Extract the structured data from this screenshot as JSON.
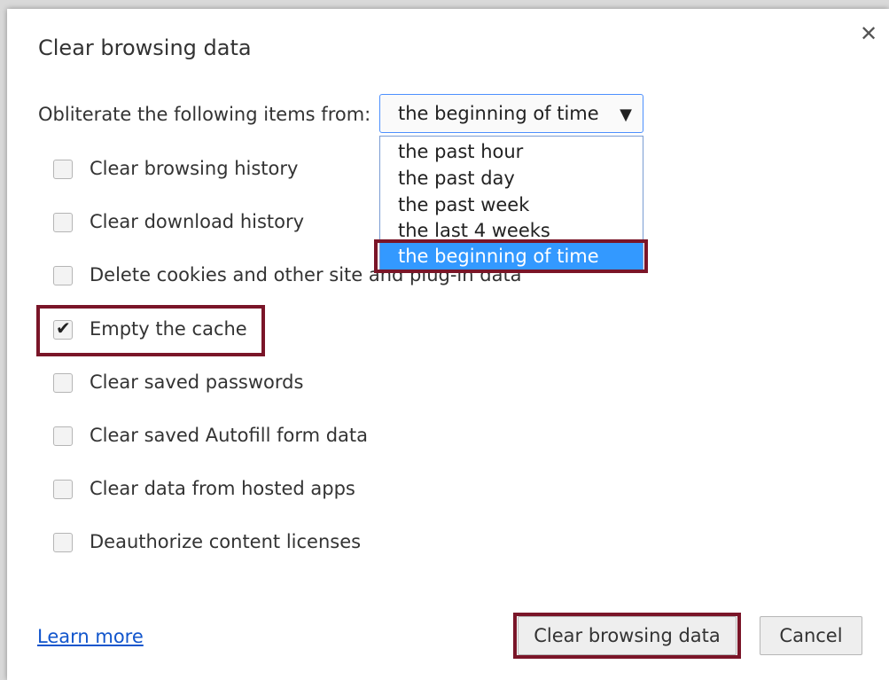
{
  "dialog": {
    "title": "Clear browsing data",
    "close_icon": "close-icon"
  },
  "time_range": {
    "label": "Obliterate the following items from:",
    "selected": "the beginning of time",
    "options": [
      "the past hour",
      "the past day",
      "the past week",
      "the last 4 weeks",
      "the beginning of time"
    ],
    "selected_index": 4
  },
  "checkboxes": [
    {
      "label": "Clear browsing history",
      "checked": false
    },
    {
      "label": "Clear download history",
      "checked": false
    },
    {
      "label": "Delete cookies and other site and plug-in data",
      "checked": false
    },
    {
      "label": "Empty the cache",
      "checked": true
    },
    {
      "label": "Clear saved passwords",
      "checked": false
    },
    {
      "label": "Clear saved Autofill form data",
      "checked": false
    },
    {
      "label": "Clear data from hosted apps",
      "checked": false
    },
    {
      "label": "Deauthorize content licenses",
      "checked": false
    }
  ],
  "footer": {
    "learn_more": "Learn more",
    "clear_button": "Clear browsing data",
    "cancel_button": "Cancel"
  },
  "colors": {
    "highlight": "#7a1528",
    "selection": "#3399ff",
    "link": "#1155cc"
  }
}
